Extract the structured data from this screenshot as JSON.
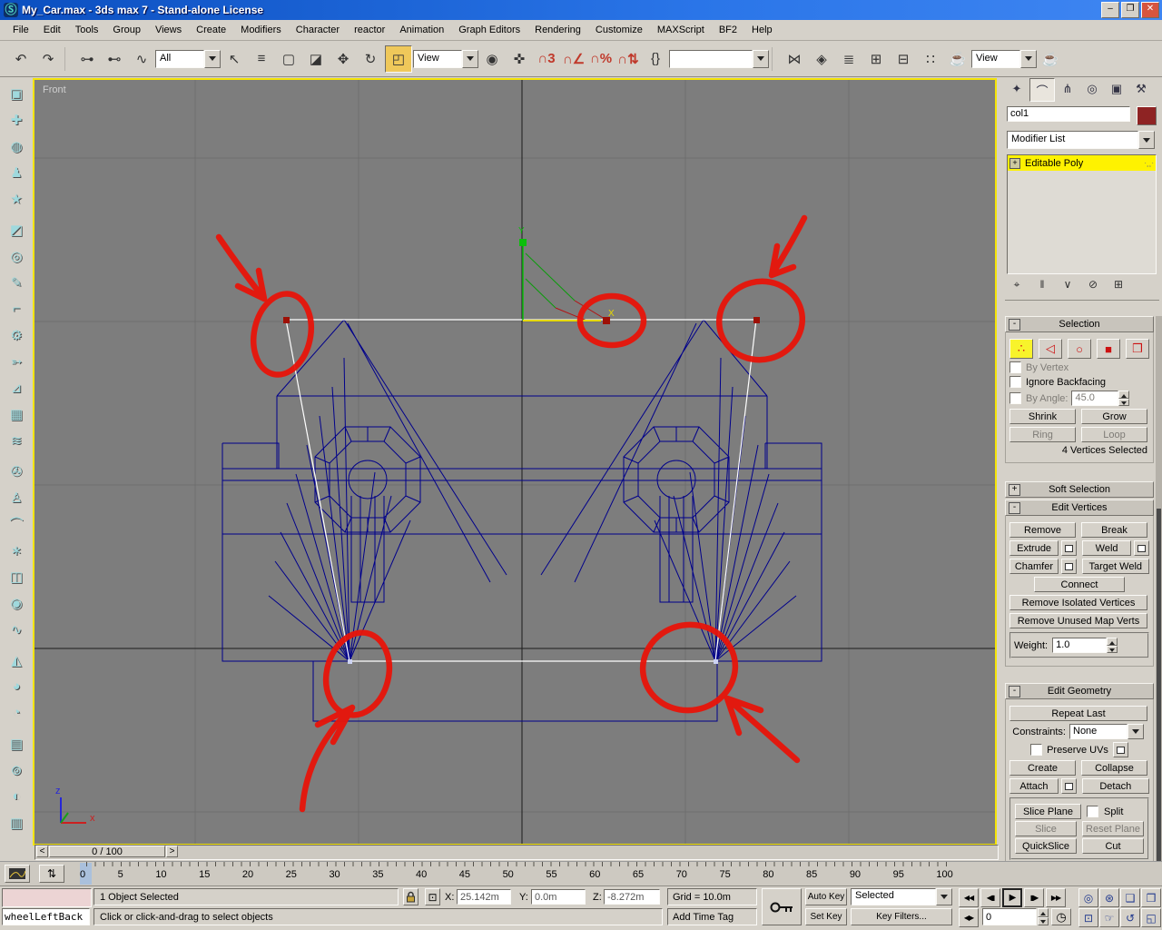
{
  "window": {
    "title": "My_Car.max - 3ds max 7  - Stand-alone License",
    "logo_glyph": "Ⓢ",
    "buttons": {
      "minimize": "–",
      "restore": "❐",
      "close": "✕"
    }
  },
  "menu": {
    "items": [
      {
        "id": "file",
        "label": "File"
      },
      {
        "id": "edit",
        "label": "Edit"
      },
      {
        "id": "tools",
        "label": "Tools"
      },
      {
        "id": "group",
        "label": "Group"
      },
      {
        "id": "views",
        "label": "Views"
      },
      {
        "id": "create",
        "label": "Create"
      },
      {
        "id": "modifiers",
        "label": "Modifiers"
      },
      {
        "id": "character",
        "label": "Character"
      },
      {
        "id": "reactor",
        "label": "reactor"
      },
      {
        "id": "animation",
        "label": "Animation"
      },
      {
        "id": "graph-editors",
        "label": "Graph Editors"
      },
      {
        "id": "rendering",
        "label": "Rendering"
      },
      {
        "id": "customize",
        "label": "Customize"
      },
      {
        "id": "maxscript",
        "label": "MAXScript"
      },
      {
        "id": "bf2",
        "label": "BF2"
      },
      {
        "id": "help",
        "label": "Help"
      }
    ]
  },
  "toolbar": {
    "selection_filter": "All",
    "ref_coord_system": "View",
    "named_selection_value": "",
    "render_type": "View",
    "g1": [
      {
        "id": "undo",
        "glyph": "↶"
      },
      {
        "id": "redo",
        "glyph": "↷"
      }
    ],
    "g2": [
      {
        "id": "select-and-link",
        "glyph": "⊶"
      },
      {
        "id": "unlink-selection",
        "glyph": "⊷"
      },
      {
        "id": "bind-to-space-warp",
        "glyph": "∿"
      }
    ],
    "g3": [
      {
        "id": "select-object",
        "glyph": "↖"
      },
      {
        "id": "select-by-name",
        "glyph": "≡"
      },
      {
        "id": "rectangular-selection-region",
        "glyph": "▢"
      },
      {
        "id": "window-crossing",
        "glyph": "◪"
      },
      {
        "id": "select-and-move",
        "glyph": "✥"
      },
      {
        "id": "select-and-rotate",
        "glyph": "↻"
      },
      {
        "id": "select-and-scale",
        "glyph": "◰",
        "style": "background:#efc85a;border:1px solid;border-color:#6f6c66 #fbfaf7 #fbfaf7 #6f6c66"
      }
    ],
    "g4": [
      {
        "id": "use-pivot-point-center",
        "glyph": "◉"
      },
      {
        "id": "select-and-manipulate",
        "glyph": "✜"
      },
      {
        "id": "snap-toggle-3d",
        "glyph": "∩3",
        "style": "color:#c0392b;font-weight:bold"
      },
      {
        "id": "angle-snap-toggle",
        "glyph": "∩∠",
        "style": "color:#c0392b;font-weight:bold"
      },
      {
        "id": "percent-snap-toggle",
        "glyph": "∩%",
        "style": "color:#c0392b;font-weight:bold"
      },
      {
        "id": "spinner-snap-toggle",
        "glyph": "∩⇅",
        "style": "color:#c0392b;font-weight:bold"
      },
      {
        "id": "named-selection-sets",
        "glyph": "{}"
      }
    ],
    "g5": [
      {
        "id": "mirror",
        "glyph": "⋈"
      },
      {
        "id": "align",
        "glyph": "◈"
      },
      {
        "id": "layer-manager",
        "glyph": "≣"
      },
      {
        "id": "curve-editor",
        "glyph": "⊞"
      },
      {
        "id": "schematic-view",
        "glyph": "⊟"
      },
      {
        "id": "material-editor",
        "glyph": "∷"
      },
      {
        "id": "render-scene",
        "glyph": "☕"
      }
    ],
    "g6": [
      {
        "id": "quick-render",
        "glyph": "☕"
      }
    ]
  },
  "left_toolbar": {
    "items": [
      {
        "id": "rigid-body-collection",
        "glyph": "▣"
      },
      {
        "id": "cloth-collection",
        "glyph": "✚"
      },
      {
        "id": "soft-body-collection",
        "glyph": "◍"
      },
      {
        "id": "rope-collection",
        "glyph": "♟"
      },
      {
        "id": "deforming-mesh-collection",
        "glyph": "★"
      },
      {
        "id": "plane",
        "glyph": "◩",
        "style": "margin-top:6px"
      },
      {
        "id": "spring",
        "glyph": "◎"
      },
      {
        "id": "linear-dashpot",
        "glyph": "✎"
      },
      {
        "id": "angular-dashpot",
        "glyph": "⌐"
      },
      {
        "id": "motor",
        "glyph": "⚙"
      },
      {
        "id": "wind",
        "glyph": "➳"
      },
      {
        "id": "toy-car",
        "glyph": "⊿"
      },
      {
        "id": "fracture",
        "glyph": "▦"
      },
      {
        "id": "water",
        "glyph": "≋"
      },
      {
        "id": "constraint-solver",
        "glyph": "✇",
        "style": "margin-top:6px"
      },
      {
        "id": "ragdoll-constraint",
        "glyph": "♙"
      },
      {
        "id": "hinge-constraint",
        "glyph": "⌒"
      },
      {
        "id": "point-point-constraint",
        "glyph": "∗"
      },
      {
        "id": "prismatic-constraint",
        "glyph": "◫"
      },
      {
        "id": "car-wheel-constraint",
        "glyph": "◉"
      },
      {
        "id": "point-path-constraint",
        "glyph": "∿"
      },
      {
        "id": "cloth-modifier",
        "glyph": "◭",
        "style": "margin-top:6px"
      },
      {
        "id": "soft-body-modifier",
        "glyph": "◕"
      },
      {
        "id": "rope-modifier",
        "glyph": "◔"
      },
      {
        "id": "property-editor",
        "glyph": "▤",
        "style": "margin-top:6px"
      },
      {
        "id": "analyze-world",
        "glyph": "⊚"
      },
      {
        "id": "preview-animation",
        "glyph": "◐"
      },
      {
        "id": "create-animation",
        "glyph": "▥"
      }
    ]
  },
  "viewport": {
    "label": "Front",
    "gizmo": {
      "x_label": "X",
      "y_label": "Y"
    },
    "axis_tripod": {
      "x": "x",
      "z": "z"
    }
  },
  "command_panel": {
    "tabs": [
      {
        "id": "create",
        "glyph": "✦"
      },
      {
        "id": "modify",
        "glyph": "⌒",
        "style": "background:#e9e5dd;border:1px solid;border-color:#6f6c66 #fbfaf7 #fbfaf7 #6f6c66"
      },
      {
        "id": "hierarchy",
        "glyph": "⋔"
      },
      {
        "id": "motion",
        "glyph": "◎"
      },
      {
        "id": "display",
        "glyph": "▣"
      },
      {
        "id": "utilities",
        "glyph": "⚒"
      }
    ],
    "object_name": "col1",
    "object_color": "#8e2323",
    "modifier_list_label": "Modifier List",
    "stack": {
      "expand_glyph": "+",
      "item": "Editable Poly",
      "highlight": "#fef200"
    },
    "stack_tools": [
      {
        "id": "pin-stack",
        "glyph": "⌖"
      },
      {
        "id": "show-end-result",
        "glyph": "‖"
      },
      {
        "id": "make-unique",
        "glyph": "∨"
      },
      {
        "id": "remove-modifier",
        "glyph": "⊘"
      },
      {
        "id": "configure-modifier-sets",
        "glyph": "⊞"
      }
    ],
    "selection": {
      "state": "-",
      "title": "Selection",
      "sub_objects": [
        {
          "id": "vertex",
          "glyph": "∴",
          "style": "background:#f8f32b"
        },
        {
          "id": "edge",
          "glyph": "◁"
        },
        {
          "id": "border",
          "glyph": "○"
        },
        {
          "id": "polygon",
          "glyph": "■"
        },
        {
          "id": "element",
          "glyph": "❒"
        }
      ],
      "by_vertex": "By Vertex",
      "ignore_backfacing": "Ignore Backfacing",
      "by_angle": "By Angle:",
      "angle_value": "45.0",
      "shrink": "Shrink",
      "grow": "Grow",
      "ring": "Ring",
      "loop": "Loop",
      "status": "4 Vertices Selected"
    },
    "soft_selection": {
      "state": "+",
      "title": "Soft Selection"
    },
    "edit_vertices": {
      "state": "-",
      "title": "Edit Vertices",
      "remove": "Remove",
      "break": "Break",
      "extrude": "Extrude",
      "weld": "Weld",
      "chamfer": "Chamfer",
      "target_weld": "Target Weld",
      "connect": "Connect",
      "remove_isolated": "Remove Isolated Vertices",
      "remove_unused": "Remove Unused Map Verts",
      "weight_label": "Weight:",
      "weight_value": "1.0"
    },
    "edit_geometry": {
      "state": "-",
      "title": "Edit Geometry",
      "repeat_last": "Repeat Last",
      "constraints_label": "Constraints:",
      "constraints_value": "None",
      "preserve_uvs": "Preserve UVs",
      "create": "Create",
      "collapse": "Collapse",
      "attach": "Attach",
      "detach": "Detach",
      "slice_plane": "Slice Plane",
      "split": "Split",
      "slice": "Slice",
      "reset_plane": "Reset Plane",
      "quickslice": "QuickSlice",
      "cut": "Cut"
    }
  },
  "timeline": {
    "slider_value": "0 / 100",
    "prev": "<",
    "next": ">",
    "ticks": [
      "0",
      "5",
      "10",
      "15",
      "20",
      "25",
      "30",
      "35",
      "40",
      "45",
      "50",
      "55",
      "60",
      "65",
      "70",
      "75",
      "80",
      "85",
      "90",
      "95",
      "100"
    ],
    "range_icon_glyph": "⇅"
  },
  "status_bar": {
    "listener_text": "wheelLeftBack",
    "selection_status": "1 Object Selected",
    "prompt": "Click or click-and-drag to select objects",
    "abs_mode_glyph": "⊡",
    "x_label": "X:",
    "x_value": "25.142m",
    "y_label": "Y:",
    "y_value": "0.0m",
    "z_label": "Z:",
    "z_value": "-8.272m",
    "grid": "Grid = 10.0m",
    "add_time_tag": "Add Time Tag",
    "auto_key": "Auto Key",
    "set_key": "Set Key",
    "key_scope": "Selected",
    "key_filters": "Key Filters...",
    "frame_value": "0",
    "time_config_glyph": "◷",
    "playback": [
      {
        "id": "go-to-start",
        "glyph": "◀◀"
      },
      {
        "id": "previous-frame",
        "glyph": "◀▮"
      },
      {
        "id": "play",
        "glyph": "▶",
        "style": "border:2px solid #222;font-size:10px"
      },
      {
        "id": "next-frame",
        "glyph": "▮▶"
      },
      {
        "id": "go-to-end",
        "glyph": "▶▶"
      }
    ],
    "key_mode_glyph": "◀▶",
    "nav": [
      {
        "id": "zoom",
        "glyph": "◎"
      },
      {
        "id": "zoom-all",
        "glyph": "⊛"
      },
      {
        "id": "zoom-extents",
        "glyph": "❑"
      },
      {
        "id": "zoom-extents-all",
        "glyph": "❒"
      },
      {
        "id": "region-zoom",
        "glyph": "⊡"
      },
      {
        "id": "pan",
        "glyph": "☞"
      },
      {
        "id": "arc-rotate",
        "glyph": "↺"
      },
      {
        "id": "min-max-toggle",
        "glyph": "◱"
      }
    ]
  },
  "colors": {
    "annotation_red": "#e8150a",
    "wireframe_navy": "#00008b",
    "viewport_grey": "#7d7d7d",
    "active_border_yellow": "#f3e408",
    "stack_highlight": "#fef200",
    "titlebar_blue": "#0b4fc0"
  }
}
